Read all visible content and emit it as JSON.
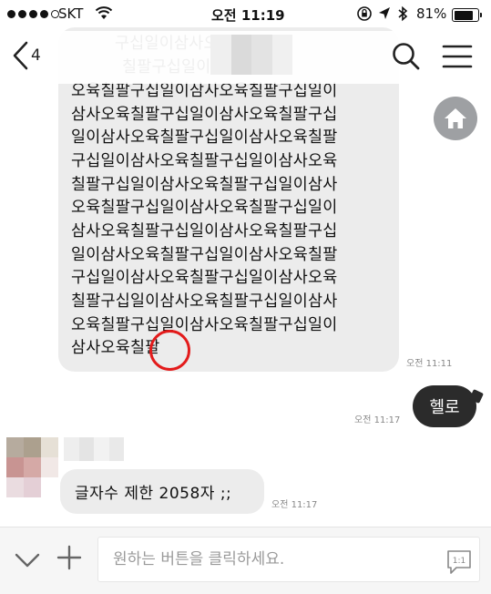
{
  "status_bar": {
    "carrier": "SKT",
    "time": "오전 11:19",
    "battery_percent": "81%",
    "battery_level": 0.81,
    "signal_bars_filled": 4,
    "signal_bars_total": 5,
    "icons": [
      "wifi-icon",
      "rotation-lock-icon",
      "location-arrow-icon",
      "bluetooth-icon",
      "battery-icon"
    ]
  },
  "header": {
    "back_count": "4",
    "icons": [
      "back-chevron-icon",
      "search-icon",
      "menu-icon"
    ]
  },
  "messages": [
    {
      "side": "left",
      "text_lines": [
        "구십일이삼사오",
        "칠팔구십일이삼",
        "오육칠팔구십일이삼사오육칠팔구십일이",
        "삼사오육칠팔구십일이삼사오육칠팔구십",
        "일이삼사오육칠팔구십일이삼사오육칠팔",
        "구십일이삼사오육칠팔구십일이삼사오육",
        "칠팔구십일이삼사오육칠팔구십일이삼사",
        "오육칠팔구십일이삼사오육칠팔구십일이",
        "삼사오육칠팔구십일이삼사오육칠팔구십",
        "일이삼사오육칠팔구십일이삼사오육칠팔",
        "구십일이삼사오육칠팔구십일이삼사오육",
        "칠팔구십일이삼사오육칠팔구십일이삼사",
        "오육칠팔구십일이삼사오육칠팔구십일이",
        "삼사오육칠팔"
      ],
      "time": "오전 11:11"
    },
    {
      "side": "right",
      "text": "헬로",
      "time": "오전 11:17"
    },
    {
      "side": "left",
      "text": "글자수 제한 2058자 ;;",
      "time": "오전 11:17"
    }
  ],
  "input_bar": {
    "placeholder": "원하는 버튼을 클릭하세요.",
    "value": "",
    "emoticon_label": "1:1"
  },
  "colors": {
    "bubble_in": "#ececec",
    "bubble_out": "#2b2b2b",
    "highlight_circle": "#e31b1b",
    "fab": "#9ea0a3"
  }
}
